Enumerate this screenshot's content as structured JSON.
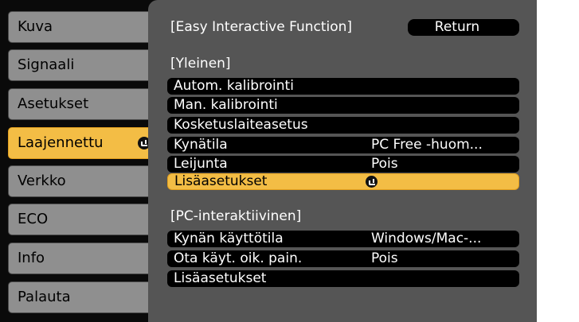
{
  "menu": {
    "items": [
      {
        "label": "Kuva"
      },
      {
        "label": "Signaali"
      },
      {
        "label": "Asetukset"
      },
      {
        "label": "Laajennettu",
        "active": true
      },
      {
        "label": "Verkko"
      },
      {
        "label": "ECO"
      },
      {
        "label": "Info"
      },
      {
        "label": "Palauta"
      }
    ]
  },
  "panel": {
    "title": "[Easy Interactive Function]",
    "return_label": "Return",
    "sections": [
      {
        "heading": "[Yleinen]",
        "rows": [
          {
            "label": "Autom. kalibrointi",
            "value": ""
          },
          {
            "label": "Man. kalibrointi",
            "value": ""
          },
          {
            "label": "Kosketuslaiteasetus",
            "value": ""
          },
          {
            "label": "Kynätila",
            "value": "PC Free -huom..."
          },
          {
            "label": "Leijunta",
            "value": "Pois"
          },
          {
            "label": "Lisäasetukset",
            "value": "",
            "selected": true
          }
        ]
      },
      {
        "heading": "[PC-interaktiivinen]",
        "rows": [
          {
            "label": "Kynän käyttötila",
            "value": "Windows/Mac-..."
          },
          {
            "label": "Ota käyt. oik. pain.",
            "value": "Pois"
          },
          {
            "label": "Lisäasetukset",
            "value": ""
          }
        ]
      }
    ]
  },
  "colors": {
    "menu_item": "#8f8f8f",
    "accent": "#f3bd45",
    "panel": "#555555",
    "row": "#000000"
  },
  "icons": {
    "enter": "enter-icon"
  }
}
